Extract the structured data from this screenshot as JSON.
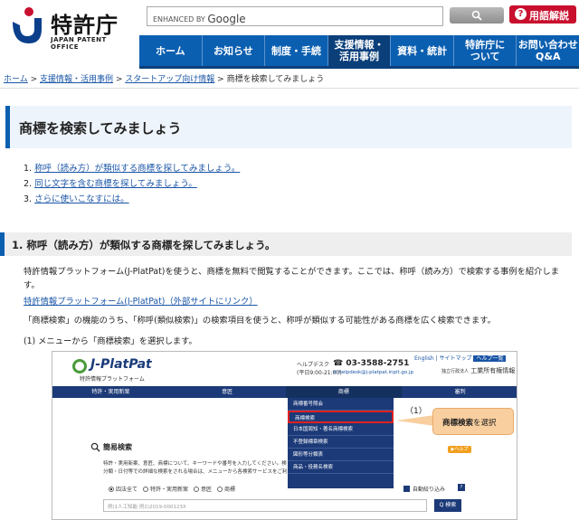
{
  "header": {
    "logo_title": "特許庁",
    "logo_sub": "JAPAN PATENT OFFICE",
    "search_placeholder_prefix": "ENHANCED BY",
    "search_placeholder_brand": "Google",
    "glossary_icon": "?",
    "glossary_label": "用語解説"
  },
  "nav": {
    "items": [
      {
        "label": "ホーム"
      },
      {
        "label": "お知らせ"
      },
      {
        "label": "制度・手続"
      },
      {
        "label": "支援情報・\n活用事例",
        "active": true
      },
      {
        "label": "資料・統計"
      },
      {
        "label": "特許庁に\nついて"
      },
      {
        "label": "お問い合わせ\nQ&A"
      }
    ]
  },
  "breadcrumb": {
    "items": [
      "ホーム",
      "支援情報・活用事例",
      "スタートアップ向け情報"
    ],
    "separator": " > ",
    "current": "商標を検索してみましょう"
  },
  "page": {
    "title": "商標を検索してみましょう"
  },
  "toc": {
    "items": [
      {
        "num": "1.",
        "label": "称呼（読み方）が類似する商標を探してみましょう。"
      },
      {
        "num": "2.",
        "label": "同じ文字を含む商標を探してみましょう。"
      },
      {
        "num": "3.",
        "label": "さらに使いこなすには。"
      }
    ]
  },
  "section1": {
    "heading": "1. 称呼（読み方）が類似する商標を探してみましょう。",
    "para1": "特許情報プラットフォーム(J-PlatPat)を使うと、商標を無料で閲覧することができます。ここでは、称呼（読み方）で検索する事例を紹介します。",
    "link": "特許情報プラットフォーム(J-PlatPat)（外部サイトにリンク）",
    "para3": "「商標検索」の機能のうち、「称呼(類似検索)」の検索項目を使うと、称呼が類似する可能性がある商標を広く検索できます。",
    "step1": "(1) メニューから「商標検索」を選択します。"
  },
  "screenshot": {
    "logo_name": "J-PlatPat",
    "logo_sub": "特許情報プラットフォーム",
    "help_label": "ヘルプデスク",
    "help_hours": "(平日9:00-21:00)",
    "phone": "03-3588-2751",
    "mail": "helpdesk@j-platpat.inpit.go.jp",
    "links": [
      "English",
      "サイトマップ",
      "ヘルプ一覧"
    ],
    "org_prefix": "独立行政法人",
    "org": "工業所有権情報・研修館",
    "nav": [
      "特許・実用新案",
      "意匠",
      "商標",
      "審判"
    ],
    "menu": [
      "商標番号照会",
      "商標検索",
      "日本国周知・著名商標検索",
      "不登録標章検索",
      "図形等分類表",
      "商品・役務名検索"
    ],
    "callout_num": "（1）",
    "callout_bold": "商標検索",
    "callout_rest": "を選択",
    "simple_search": "簡易検索",
    "hint": "▶ヘルプ",
    "desc1": "特許・実用新案、意匠、商標について、キーワードや番号を入力してください。検",
    "desc2": "分類・日付等での詳細な検索をされる場合は、メニューから各検索サービスをご利",
    "radios": [
      "四法全て",
      "特許・実用新案",
      "意匠",
      "商標"
    ],
    "auto_label": "自動絞り込み",
    "auto_help": "?",
    "input_placeholder": "例)1人工知能  例2)2019-000123X",
    "search_btn": "Q 検索"
  }
}
